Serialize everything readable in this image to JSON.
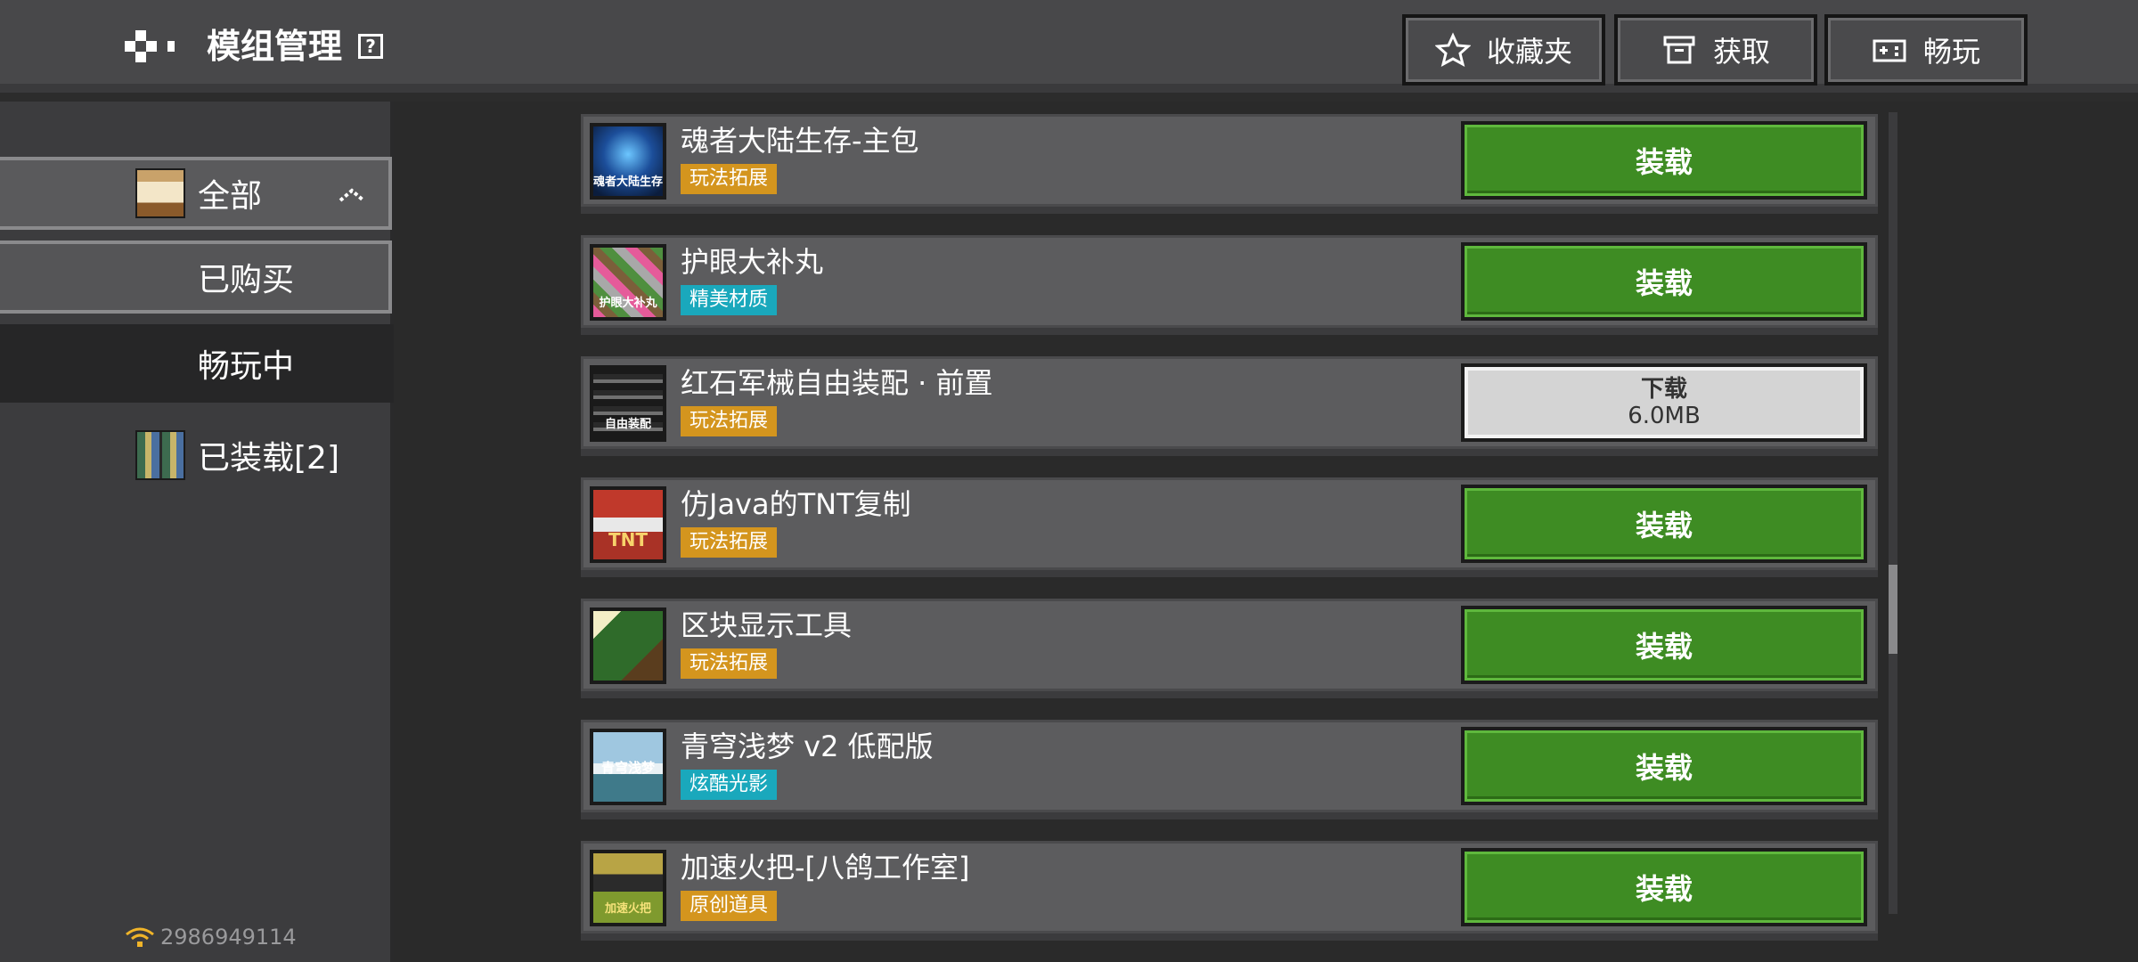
{
  "header": {
    "title": "模组管理",
    "help": "?",
    "buttons": [
      {
        "label": "收藏夹",
        "icon": "star-icon"
      },
      {
        "label": "获取",
        "icon": "box-icon"
      },
      {
        "label": "畅玩",
        "icon": "gamepad-icon"
      }
    ]
  },
  "sidebar": {
    "items": [
      {
        "label": "全部",
        "icon": "chest-icon",
        "expanded": true
      },
      {
        "label": "已购买"
      },
      {
        "label": "畅玩中"
      },
      {
        "label": "已装载[2]",
        "icon": "bookshelf-icon"
      }
    ],
    "user_id": "2986949114"
  },
  "mods": [
    {
      "name": "魂者大陆生存-主包",
      "tag": "玩法拓展",
      "tag_color": "#d4951e",
      "action": "装载",
      "thumb_text": "魂者大陆生存"
    },
    {
      "name": "护眼大补丸",
      "tag": "精美材质",
      "tag_color": "#1aa8bc",
      "action": "装载",
      "thumb_text": "护眼大补丸"
    },
    {
      "name": "红石军械自由装配 · 前置",
      "tag": "玩法拓展",
      "tag_color": "#d4951e",
      "action": "下载",
      "size": "6.0MB",
      "thumb_text": "自由装配"
    },
    {
      "name": "仿Java的TNT复制",
      "tag": "玩法拓展",
      "tag_color": "#d4951e",
      "action": "装载",
      "thumb_text": "TNT"
    },
    {
      "name": "区块显示工具",
      "tag": "玩法拓展",
      "tag_color": "#d4951e",
      "action": "装载",
      "thumb_text": ""
    },
    {
      "name": "青穹浅梦 v2 低配版",
      "tag": "炫酷光影",
      "tag_color": "#1aa8bc",
      "action": "装载",
      "thumb_text": "青穹浅梦"
    },
    {
      "name": "加速火把-[八鸽工作室]",
      "tag": "原创道具",
      "tag_color": "#d4951e",
      "action": "装载",
      "thumb_text": "加速火把"
    }
  ],
  "colors": {
    "load_button": "#3e8c23",
    "download_button": "#d4d4d4",
    "tag_orange": "#d4951e",
    "tag_cyan": "#1aa8bc"
  }
}
